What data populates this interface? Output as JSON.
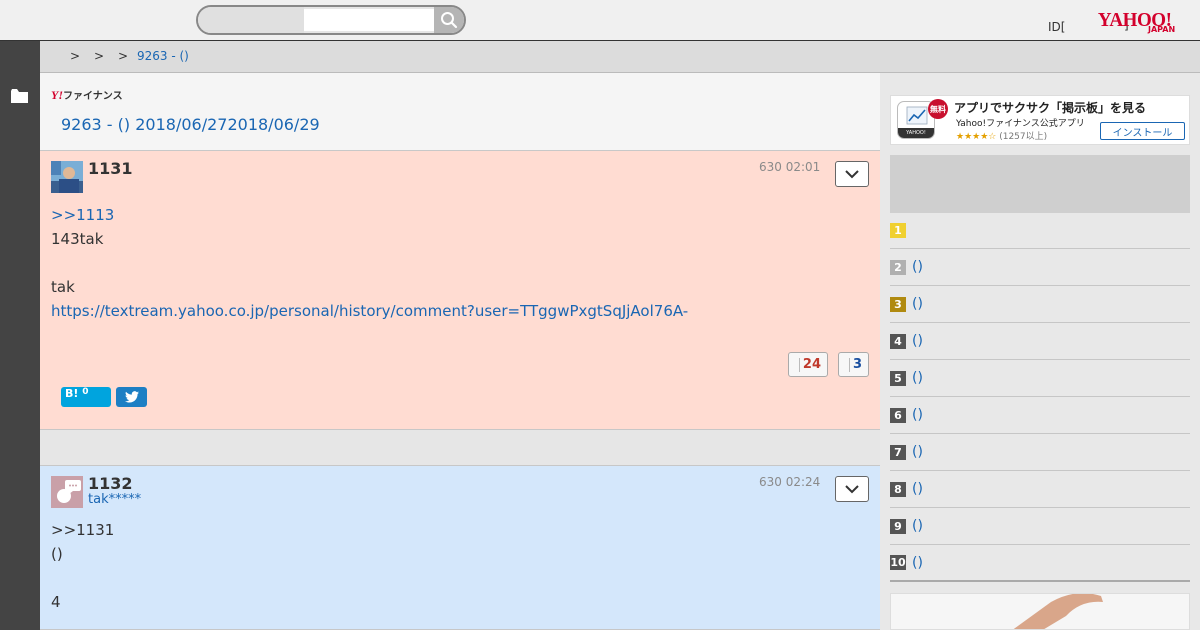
{
  "header": {
    "search_placeholder": "",
    "login_text": "ID[",
    "login_close": "]",
    "logo_main": "YAHOO!",
    "logo_sub": "JAPAN"
  },
  "breadcrumb": {
    "sep1": ">",
    "sep2": ">",
    "sep3": ">",
    "current": "9263 - ()"
  },
  "board": {
    "brand_y": "Y!",
    "brand_text": "ファイナンス",
    "title": "9263 - () 2018/06/272018/06/29"
  },
  "posts": [
    {
      "number": "1131",
      "author": "",
      "time": "630 02:01",
      "lines": [
        ">>1113",
        "143tak",
        "",
        "tak",
        "https://textream.yahoo.co.jp/personal/history/comment?user=TTggwPxgtSqJjAol76A-"
      ],
      "good_count": "24",
      "bad_count": "3",
      "hatena_label": "B!",
      "hatena_count": "0"
    },
    {
      "number": "1132",
      "author": "tak*****",
      "time": "630 02:24",
      "lines": [
        ">>1131",
        "()",
        "",
        "4"
      ]
    }
  ],
  "sidebar": {
    "app": {
      "badge": "無料",
      "title": "アプリでサクサク「掲示板」を見る",
      "subtitle": "Yahoo!ファイナンス公式アプリ",
      "stars": "★★★★☆",
      "reviews": "(1257以上)",
      "install": "インストール",
      "icon_text": "YAHOO!"
    },
    "ranking": [
      {
        "num": "1",
        "label": "",
        "color": "#f0d030"
      },
      {
        "num": "2",
        "label": "()",
        "color": "#b0b0b0"
      },
      {
        "num": "3",
        "label": "()",
        "color": "#b08a10"
      },
      {
        "num": "4",
        "label": "()",
        "color": "#555555"
      },
      {
        "num": "5",
        "label": "()",
        "color": "#555555"
      },
      {
        "num": "6",
        "label": "()",
        "color": "#555555"
      },
      {
        "num": "7",
        "label": "()",
        "color": "#555555"
      },
      {
        "num": "8",
        "label": "()",
        "color": "#555555"
      },
      {
        "num": "9",
        "label": "()",
        "color": "#555555"
      },
      {
        "num": "10",
        "label": "()",
        "color": "#555555"
      }
    ]
  }
}
